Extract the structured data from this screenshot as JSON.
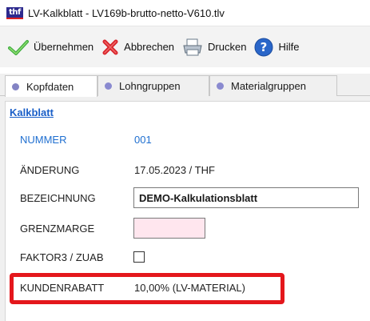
{
  "window": {
    "app_icon_text": "thf",
    "title": "LV-Kalkblatt - LV169b-brutto-netto-V610.tlv"
  },
  "toolbar": {
    "buttons": [
      {
        "label": "Übernehmen",
        "icon": "checkmark-icon"
      },
      {
        "label": "Abbrechen",
        "icon": "cancel-x-icon"
      },
      {
        "label": "Drucken",
        "icon": "printer-icon"
      },
      {
        "label": "Hilfe",
        "icon": "help-icon"
      }
    ]
  },
  "tabs": [
    {
      "label": "Kopfdaten",
      "active": true
    },
    {
      "label": "Lohngruppen",
      "active": false
    },
    {
      "label": "Materialgruppen",
      "active": false
    }
  ],
  "form": {
    "section_title": "Kalkblatt",
    "nummer": {
      "label": "NUMMER",
      "value": "001"
    },
    "aenderung": {
      "label": "ÄNDERUNG",
      "value": "17.05.2023 / THF"
    },
    "bezeichnung": {
      "label": "BEZEICHNUNG",
      "value": "DEMO-Kalkulationsblatt"
    },
    "grenzmarge": {
      "label": "GRENZMARGE",
      "value": ""
    },
    "faktor3": {
      "label": "FAKTOR3 / ZUAB",
      "checked": false
    },
    "kundenrabatt": {
      "label": "KUNDENRABATT",
      "value": "10,00% (LV-MATERIAL)"
    }
  },
  "colors": {
    "label_blue": "#1f6fd0",
    "highlight_red": "#e4171c",
    "grenzmarge_bg": "#ffe6ee"
  }
}
